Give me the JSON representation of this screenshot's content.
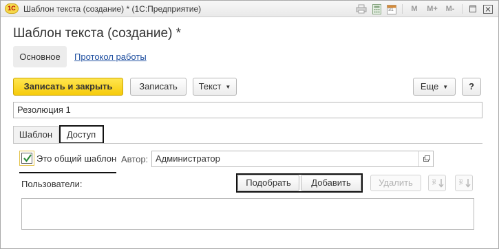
{
  "window": {
    "title": "Шаблон текста (создание) * (1С:Предприятие)",
    "logo_text": "1С"
  },
  "titlebar_icons": [
    "printer-icon",
    "calculator-icon",
    "calendar-icon",
    "m-button",
    "m-plus-button",
    "m-minus-button",
    "restore-icon",
    "close-icon"
  ],
  "titlebar_labels": {
    "calendar_day": "31",
    "m": "M",
    "m_plus": "M+",
    "m_minus": "M-"
  },
  "header": {
    "title": "Шаблон текста (создание) *",
    "nav": {
      "main": "Основное",
      "log": "Протокол работы"
    }
  },
  "toolbar": {
    "save_close": "Записать и закрыть",
    "save": "Записать",
    "text": "Текст",
    "more": "Еще",
    "help": "?"
  },
  "name_field": {
    "value": "Резолюция 1"
  },
  "tabs": {
    "template": "Шаблон",
    "access": "Доступ"
  },
  "access": {
    "shared_label": "Это общий шаблон",
    "shared_checked": true,
    "author_label": "Автор:",
    "author_value": "Администратор",
    "users_label": "Пользователи:",
    "pick": "Подобрать",
    "add": "Добавить",
    "delete": "Удалить",
    "sort_glyph": "ЯА"
  },
  "colors": {
    "primary_button": "#f6cb0b",
    "link": "#1f4fa0",
    "check": "#2a8a3a",
    "highlight_frame": "#111111"
  }
}
